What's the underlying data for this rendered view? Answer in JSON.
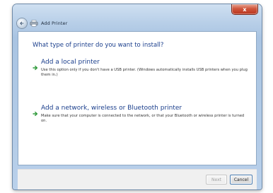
{
  "window": {
    "title": "Add Printer",
    "close_glyph": "x"
  },
  "main": {
    "heading": "What type of printer do you want to install?",
    "options": [
      {
        "title": "Add a local printer",
        "description": "Use this option only if you don't have a USB printer. (Windows automatically installs USB printers when you plug them in.)"
      },
      {
        "title": "Add a network, wireless or Bluetooth printer",
        "description": "Make sure that your computer is connected to the network, or that your Bluetooth or wireless printer is turned on."
      }
    ]
  },
  "footer": {
    "next_label": "Next",
    "cancel_label": "Cancel"
  },
  "icons": {
    "back": "back-arrow-icon",
    "printer": "printer-icon",
    "option_arrow": "green-arrow-icon"
  },
  "colors": {
    "heading": "#1a3e8c",
    "option_arrow": "#2f9a3a",
    "close_button": "#c8442a"
  }
}
